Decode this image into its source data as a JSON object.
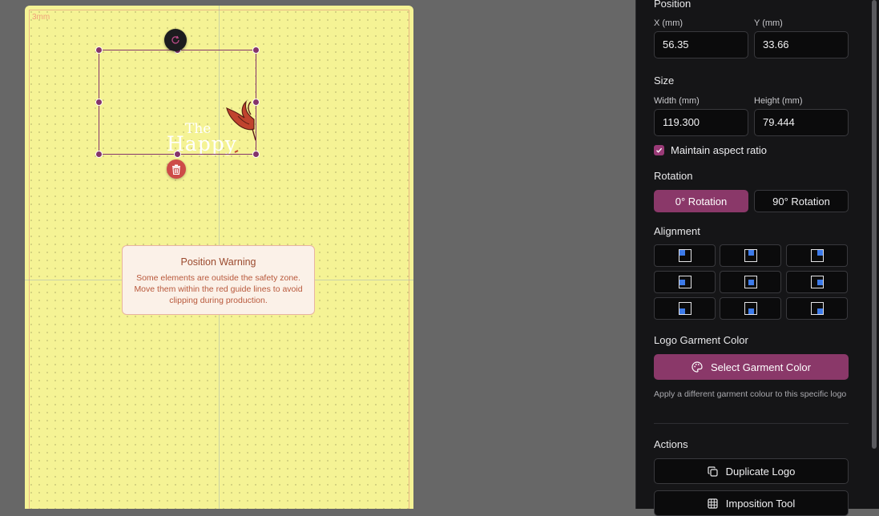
{
  "canvas": {
    "bleed_label": "3mm",
    "logo": {
      "line1": "The",
      "line2": "Happy"
    },
    "warning": {
      "title": "Position Warning",
      "message": "Some elements are outside the safety zone. Move them within the red guide lines to avoid clipping during production."
    }
  },
  "panel": {
    "position": {
      "title": "Position",
      "x_label": "X (mm)",
      "x_value": "56.35",
      "y_label": "Y (mm)",
      "y_value": "33.66"
    },
    "size": {
      "title": "Size",
      "width_label": "Width (mm)",
      "width_value": "119.300",
      "height_label": "Height (mm)",
      "height_value": "79.444",
      "aspect_label": "Maintain aspect ratio",
      "aspect_checked": true
    },
    "rotation": {
      "title": "Rotation",
      "option_0": "0° Rotation",
      "option_90": "90° Rotation",
      "selected": "0° Rotation"
    },
    "alignment": {
      "title": "Alignment",
      "options": [
        "top-left",
        "top-center",
        "top-right",
        "middle-left",
        "center",
        "middle-right",
        "bottom-left",
        "bottom-center",
        "bottom-right"
      ]
    },
    "garment": {
      "title": "Logo Garment Color",
      "button_label": "Select Garment Color",
      "help": "Apply a different garment colour to this specific logo"
    },
    "actions": {
      "title": "Actions",
      "duplicate_label": "Duplicate Logo",
      "imposition_label": "Imposition Tool"
    }
  },
  "colors": {
    "accent": "#8a3869",
    "artboard": "#f5f395",
    "panel_bg": "#151517",
    "alignment_marker": "#3d7bea",
    "delete": "#cd4b48"
  }
}
